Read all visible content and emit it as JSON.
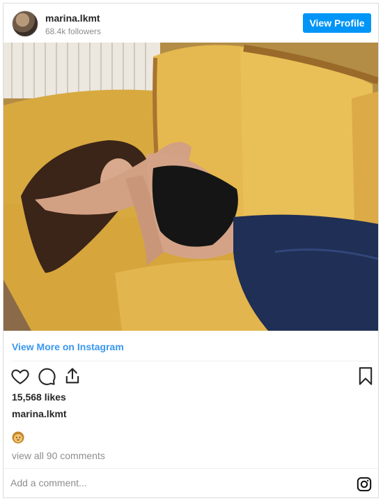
{
  "header": {
    "username": "marina.lkmt",
    "followers": "68.4k followers",
    "view_profile_label": "View Profile"
  },
  "post": {
    "view_more_label": "View More on Instagram",
    "likes": "15,568 likes",
    "caption_username": "marina.lkmt",
    "caption_emoji": "lion-face-emoji",
    "view_comments": "view all 90 comments",
    "comment_placeholder": "Add a comment..."
  },
  "icons": {
    "like": "heart-icon",
    "comment": "comment-icon",
    "share": "share-icon",
    "save": "bookmark-icon",
    "brand": "instagram-icon"
  },
  "colors": {
    "accent": "#0095f6",
    "link": "#3897f0",
    "muted": "#8e8e8e",
    "border": "#dbdbdb"
  }
}
